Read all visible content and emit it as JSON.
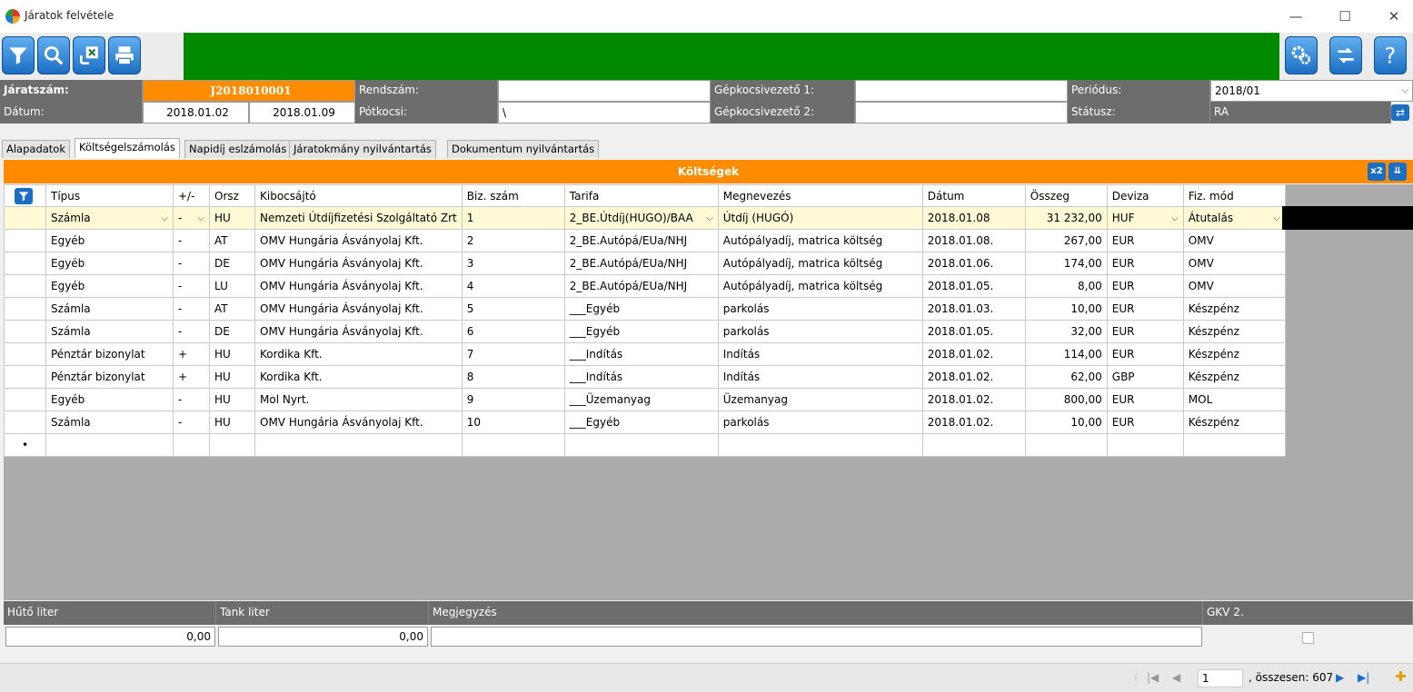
{
  "window": {
    "title": "Járatok felvétele"
  },
  "form": {
    "jaratszam_label": "Járatszám:",
    "jaratszam_value": "J2018010001",
    "rendszam_label": "Rendszám:",
    "rendszam_value": "",
    "gepkocsivezeto1_label": "Gépkocsivezető 1:",
    "gepkocsivezeto1_value": "",
    "periodus_label": "Periódus:",
    "periodus_value": "2018/01",
    "datum_label": "Dátum:",
    "datum_from": "2018.01.02",
    "datum_to": "2018.01.09",
    "potkocsi_label": "Pótkocsi:",
    "potkocsi_value": "\\",
    "gepkocsivezeto2_label": "Gépkocsivezető 2:",
    "gepkocsivezeto2_value": "",
    "statusz_label": "Státusz:",
    "statusz_value": "RA"
  },
  "tabs": [
    {
      "label": "Alapadatok"
    },
    {
      "label": "Költségelszámolás"
    },
    {
      "label": "Napidíj eslzámolás"
    },
    {
      "label": "Járatokmány nyilvántartás"
    },
    {
      "label": "Dokumentum nyilvántartás"
    }
  ],
  "section": {
    "title": "Költségek",
    "x2_label": "x2"
  },
  "grid": {
    "columns": [
      "Típus",
      "+/-",
      "Orsz",
      "Kibocsájtó",
      "Biz. szám",
      "Tarifa",
      "Megnevezés",
      "Dátum",
      "Összeg",
      "Deviza",
      "Fiz. mód"
    ],
    "rows": [
      [
        "Számla",
        "-",
        "HU",
        "Nemzeti Útdíjfizetési Szolgáltató Zrt",
        "1",
        "2_BE.Útdíj(HUGO)/BAA",
        "Útdíj (HUGÓ)",
        "2018.01.08",
        "31 232,00",
        "HUF",
        "Átutalás"
      ],
      [
        "Egyéb",
        "-",
        "AT",
        "OMV Hungária Ásványolaj Kft.",
        "2",
        "2_BE.Autópá/EUa/NHJ",
        "Autópályadíj, matrica költség",
        "2018.01.08.",
        "267,00",
        "EUR",
        "OMV"
      ],
      [
        "Egyéb",
        "-",
        "DE",
        "OMV Hungária Ásványolaj Kft.",
        "3",
        "2_BE.Autópá/EUa/NHJ",
        "Autópályadíj, matrica költség",
        "2018.01.06.",
        "174,00",
        "EUR",
        "OMV"
      ],
      [
        "Egyéb",
        "-",
        "LU",
        "OMV Hungária Ásványolaj Kft.",
        "4",
        "2_BE.Autópá/EUa/NHJ",
        "Autópályadíj, matrica költség",
        "2018.01.05.",
        "8,00",
        "EUR",
        "OMV"
      ],
      [
        "Számla",
        "-",
        "AT",
        "OMV Hungária Ásványolaj Kft.",
        "5",
        "___Egyéb",
        "parkolás",
        "2018.01.03.",
        "10,00",
        "EUR",
        "Készpénz"
      ],
      [
        "Számla",
        "-",
        "DE",
        "OMV Hungária Ásványolaj Kft.",
        "6",
        "___Egyéb",
        "parkolás",
        "2018.01.05.",
        "32,00",
        "EUR",
        "Készpénz"
      ],
      [
        "Pénztár bizonylat",
        "+",
        "HU",
        "Kordika Kft.",
        "7",
        "___Indítás",
        "Indítás",
        "2018.01.02.",
        "114,00",
        "EUR",
        "Készpénz"
      ],
      [
        "Pénztár bizonylat",
        "+",
        "HU",
        "Kordika Kft.",
        "8",
        "___Indítás",
        "Indítás",
        "2018.01.02.",
        "62,00",
        "GBP",
        "Készpénz"
      ],
      [
        "Egyéb",
        "-",
        "HU",
        "Mol Nyrt.",
        "9",
        "___Üzemanyag",
        "Üzemanyag",
        "2018.01.02.",
        "800,00",
        "EUR",
        "MOL"
      ],
      [
        "Számla",
        "-",
        "HU",
        "OMV Hungária Ásványolaj Kft.",
        "10",
        "___Egyéb",
        "parkolás",
        "2018.01.02.",
        "10,00",
        "EUR",
        "Készpénz"
      ]
    ],
    "new_row_marker": "•"
  },
  "footer": {
    "huto_label": "Hűtő liter",
    "huto_value": "0,00",
    "tank_label": "Tank liter",
    "tank_value": "0,00",
    "megjegyzes_label": "Megjegyzés",
    "gkv_label": "GKV 2."
  },
  "status": {
    "current_record": "1",
    "total_label": ", összesen: 607"
  }
}
